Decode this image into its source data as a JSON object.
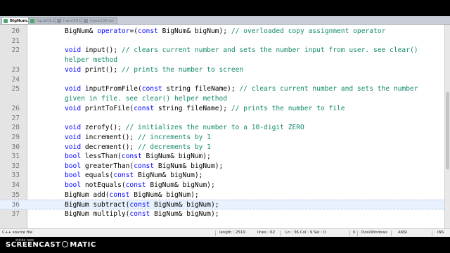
{
  "tabs": [
    "BigNum.h",
    "input01.txt",
    "input20.txt",
    "input100.txt"
  ],
  "lines": [
    {
      "n": "20",
      "parts": [
        {
          "t": "BigNum& "
        },
        {
          "t": "operator",
          "c": "kw"
        },
        {
          "t": "=("
        },
        {
          "t": "const",
          "c": "kw"
        },
        {
          "t": " BigNum& bigNum); "
        },
        {
          "t": "// overloaded copy assignment operator",
          "c": "cm"
        }
      ]
    },
    {
      "n": "21",
      "parts": []
    },
    {
      "n": "22",
      "parts": [
        {
          "t": "void",
          "c": "kw"
        },
        {
          "t": " input(); "
        },
        {
          "t": "// clears current number and sets the number input from user. see clear() helper method",
          "c": "cm"
        }
      ]
    },
    {
      "n": "23",
      "parts": [
        {
          "t": "void",
          "c": "kw"
        },
        {
          "t": " print(); "
        },
        {
          "t": "// prints the number to screen",
          "c": "cm"
        }
      ]
    },
    {
      "n": "24",
      "parts": []
    },
    {
      "n": "25",
      "parts": [
        {
          "t": "void",
          "c": "kw"
        },
        {
          "t": " inputFromFile("
        },
        {
          "t": "const",
          "c": "kw"
        },
        {
          "t": " string fileName); "
        },
        {
          "t": "// clears current number and sets the number given in file. see clear() helper method",
          "c": "cm"
        }
      ]
    },
    {
      "n": "26",
      "parts": [
        {
          "t": "void",
          "c": "kw"
        },
        {
          "t": " printToFile("
        },
        {
          "t": "const",
          "c": "kw"
        },
        {
          "t": " string fileName); "
        },
        {
          "t": "// prints the number to file",
          "c": "cm"
        }
      ]
    },
    {
      "n": "27",
      "parts": []
    },
    {
      "n": "28",
      "parts": [
        {
          "t": "void",
          "c": "kw"
        },
        {
          "t": " zerofy(); "
        },
        {
          "t": "// initializes the number to a 10-digit ZERO",
          "c": "cm"
        }
      ]
    },
    {
      "n": "29",
      "parts": [
        {
          "t": "void",
          "c": "kw"
        },
        {
          "t": " increment(); "
        },
        {
          "t": "// increments by 1",
          "c": "cm"
        }
      ]
    },
    {
      "n": "30",
      "parts": [
        {
          "t": "void",
          "c": "kw"
        },
        {
          "t": " decrement(); "
        },
        {
          "t": "// decrements by 1",
          "c": "cm"
        }
      ]
    },
    {
      "n": "31",
      "parts": [
        {
          "t": "bool",
          "c": "kw"
        },
        {
          "t": " lessThan("
        },
        {
          "t": "const",
          "c": "kw"
        },
        {
          "t": " BigNum& bigNum);"
        }
      ]
    },
    {
      "n": "32",
      "parts": [
        {
          "t": "bool",
          "c": "kw"
        },
        {
          "t": " greaterThan("
        },
        {
          "t": "const",
          "c": "kw"
        },
        {
          "t": " BigNum& bigNum);"
        }
      ]
    },
    {
      "n": "33",
      "parts": [
        {
          "t": "bool",
          "c": "kw"
        },
        {
          "t": " equals("
        },
        {
          "t": "const",
          "c": "kw"
        },
        {
          "t": " BigNum& bigNum);"
        }
      ]
    },
    {
      "n": "34",
      "parts": [
        {
          "t": "bool",
          "c": "kw"
        },
        {
          "t": " notEquals("
        },
        {
          "t": "const",
          "c": "kw"
        },
        {
          "t": " BigNum& bigNum);"
        }
      ]
    },
    {
      "n": "35",
      "parts": [
        {
          "t": "BigNum add("
        },
        {
          "t": "const",
          "c": "kw"
        },
        {
          "t": " BigNum& bigNum);"
        }
      ]
    },
    {
      "n": "36",
      "parts": [
        {
          "t": "BigNum subtract("
        },
        {
          "t": "const",
          "c": "kw"
        },
        {
          "t": " BigNum& bigNum);"
        }
      ],
      "current": true
    },
    {
      "n": "37",
      "parts": [
        {
          "t": "BigNum multiply("
        },
        {
          "t": "const",
          "c": "kw"
        },
        {
          "t": " BigNum& bigNum);"
        }
      ]
    }
  ],
  "status": {
    "file_type": "C++ source file",
    "length": "length : 2519",
    "lines": "lines : 62",
    "position": "Ln : 36   Col : 9   Sel : 0",
    "zero": "0",
    "eol": "Dos\\Windows",
    "encoding": "ANSI",
    "mode": "INS"
  },
  "watermark": {
    "left": "SCREENCAST",
    "right": "MATIC",
    "small": "sticks now"
  },
  "colors": {
    "keyword": "#0000ff",
    "comment": "#12896c",
    "current_line": "#e8f2fe",
    "gutter": "#e4e4e4",
    "tab_icon_saved": "#4da86a"
  }
}
